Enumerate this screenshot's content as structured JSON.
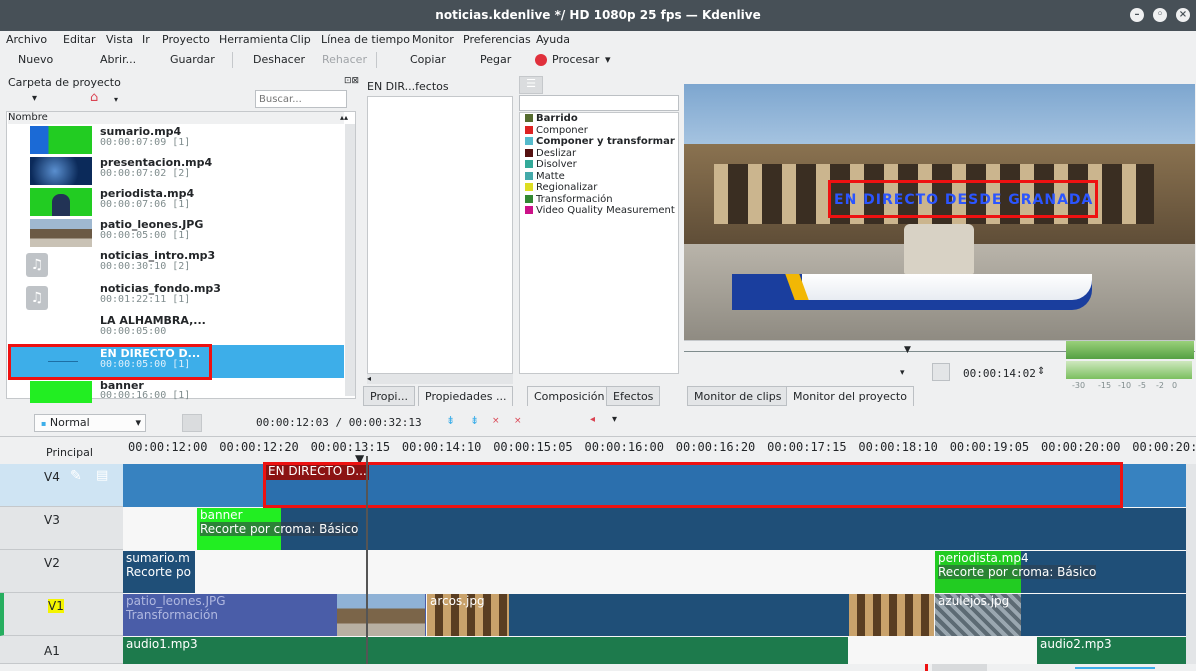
{
  "window": {
    "title": "noticias.kdenlive */ HD 1080p 25 fps — Kdenlive"
  },
  "menu": [
    "Archivo",
    "Editar",
    "Vista",
    "Ir",
    "Proyecto",
    "Herramienta",
    "Clip",
    "Línea de tiempo",
    "Monitor",
    "Preferencias",
    "Ayuda"
  ],
  "toolbar": {
    "nuevo": "Nuevo",
    "abrir": "Abrir...",
    "guardar": "Guardar",
    "deshacer": "Deshacer",
    "rehacer": "Rehacer",
    "copiar": "Copiar",
    "pegar": "Pegar",
    "procesar": "Procesar"
  },
  "project_bin": {
    "title": "Carpeta de proyecto",
    "search_placeholder": "Buscar...",
    "column_header": "Nombre",
    "clips": [
      {
        "name": "sumario.mp4",
        "duration": "00:00:07:09 [1]"
      },
      {
        "name": "presentacion.mp4",
        "duration": "00:00:07:02 [2]"
      },
      {
        "name": "periodista.mp4",
        "duration": "00:00:07:06 [1]"
      },
      {
        "name": "patio_leones.JPG",
        "duration": "00:00:05:00 [1]"
      },
      {
        "name": "noticias_intro.mp3",
        "duration": "00:00:30:10 [2]"
      },
      {
        "name": "noticias_fondo.mp3",
        "duration": "00:01:22:11 [1]"
      },
      {
        "name": "LA ALHAMBRA,...",
        "duration": "00:00:05:00"
      },
      {
        "name": "EN DIRECTO D...",
        "duration": "00:00:05:00 [1]"
      },
      {
        "name": "banner",
        "duration": "00:00:16:00 [1]"
      }
    ],
    "tabs": [
      "Propi...",
      "Propiedades ..."
    ]
  },
  "effects_panel": {
    "title": "EN DIR...fectos",
    "items": [
      {
        "label": "Barrido",
        "bold": true,
        "color": "#556b2f"
      },
      {
        "label": "Componer",
        "bold": false,
        "color": "#dd2222"
      },
      {
        "label": "Componer y transformar",
        "bold": true,
        "color": "#55bbcc"
      },
      {
        "label": "Deslizar",
        "bold": false,
        "color": "#551111"
      },
      {
        "label": "Disolver",
        "bold": false,
        "color": "#33aa99"
      },
      {
        "label": "Matte",
        "bold": false,
        "color": "#44aaaa"
      },
      {
        "label": "Regionalizar",
        "bold": false,
        "color": "#dddd22"
      },
      {
        "label": "Transformación",
        "bold": false,
        "color": "#338833"
      },
      {
        "label": "Video Quality Measurement",
        "bold": false,
        "color": "#cc1188"
      }
    ],
    "tabs": [
      "Composición",
      "Efectos"
    ]
  },
  "monitor": {
    "overlay_text": "EN DIRECTO DESDE GRANADA",
    "timecode": "00:00:14:02",
    "audio_scale": [
      "-30",
      "-15",
      "-10",
      "-5",
      "-2",
      "0"
    ],
    "tabs": [
      "Monitor de clips",
      "Monitor del proyecto"
    ]
  },
  "timeline_toolbar": {
    "mode": "Normal",
    "position": "00:00:12:03 / 00:00:32:13"
  },
  "timeline": {
    "master_label": "Principal",
    "ruler": [
      "00:00:12:00",
      "00:00:12:20",
      "00:00:13:15",
      "00:00:14:10",
      "00:00:15:05",
      "00:00:16:00",
      "00:00:16:20",
      "00:00:17:15",
      "00:00:18:10",
      "00:00:19:05",
      "00:00:20:00",
      "00:00:20:2"
    ],
    "tracks": [
      "V4",
      "V3",
      "V2",
      "V1",
      "A1"
    ],
    "clips": {
      "v4_title": "EN DIRECTO D...",
      "banner": "banner",
      "banner_effect": "Recorte por croma: Básico",
      "sumario": "sumario.m",
      "sumario_effect": "Recorte po",
      "periodista": "periodista.mp4",
      "periodista_effect": "Recorte por croma: Básico",
      "patio": "patio_leones.JPG",
      "patio_effect": "Transformación",
      "arcos": "arcos.jpg",
      "azulejos": "azulejos.jpg",
      "audio1": "audio1.mp3",
      "audio2": "audio2.mp3"
    }
  }
}
